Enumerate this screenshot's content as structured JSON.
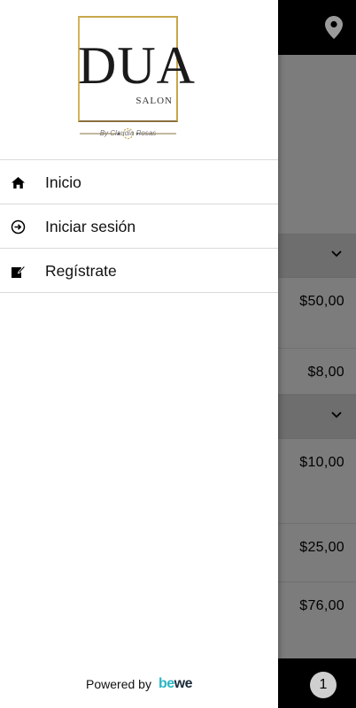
{
  "drawer": {
    "logo_text": "DUA",
    "logo_subtext": "SALON",
    "logo_byline": "By Claudia Rosas",
    "menu": [
      {
        "label": "Inicio",
        "icon": "home-icon"
      },
      {
        "label": "Iniciar sesión",
        "icon": "login-icon"
      },
      {
        "label": "Regístrate",
        "icon": "edit-icon"
      }
    ],
    "powered_by": "Powered by",
    "powered_brand_a": "be",
    "powered_brand_b": "we"
  },
  "background": {
    "prices": [
      "$50,00",
      "$8,00",
      "$10,00",
      "$25,00",
      "$76,00"
    ],
    "cart_count": "1",
    "carousel_dots": {
      "count": 2,
      "active": 0
    }
  },
  "colors": {
    "logo_gold": "#c9a64a",
    "brand_teal": "#2bb6c4",
    "brand_dark": "#1b2b3a",
    "overlay_gray": "#7c7c7c"
  }
}
